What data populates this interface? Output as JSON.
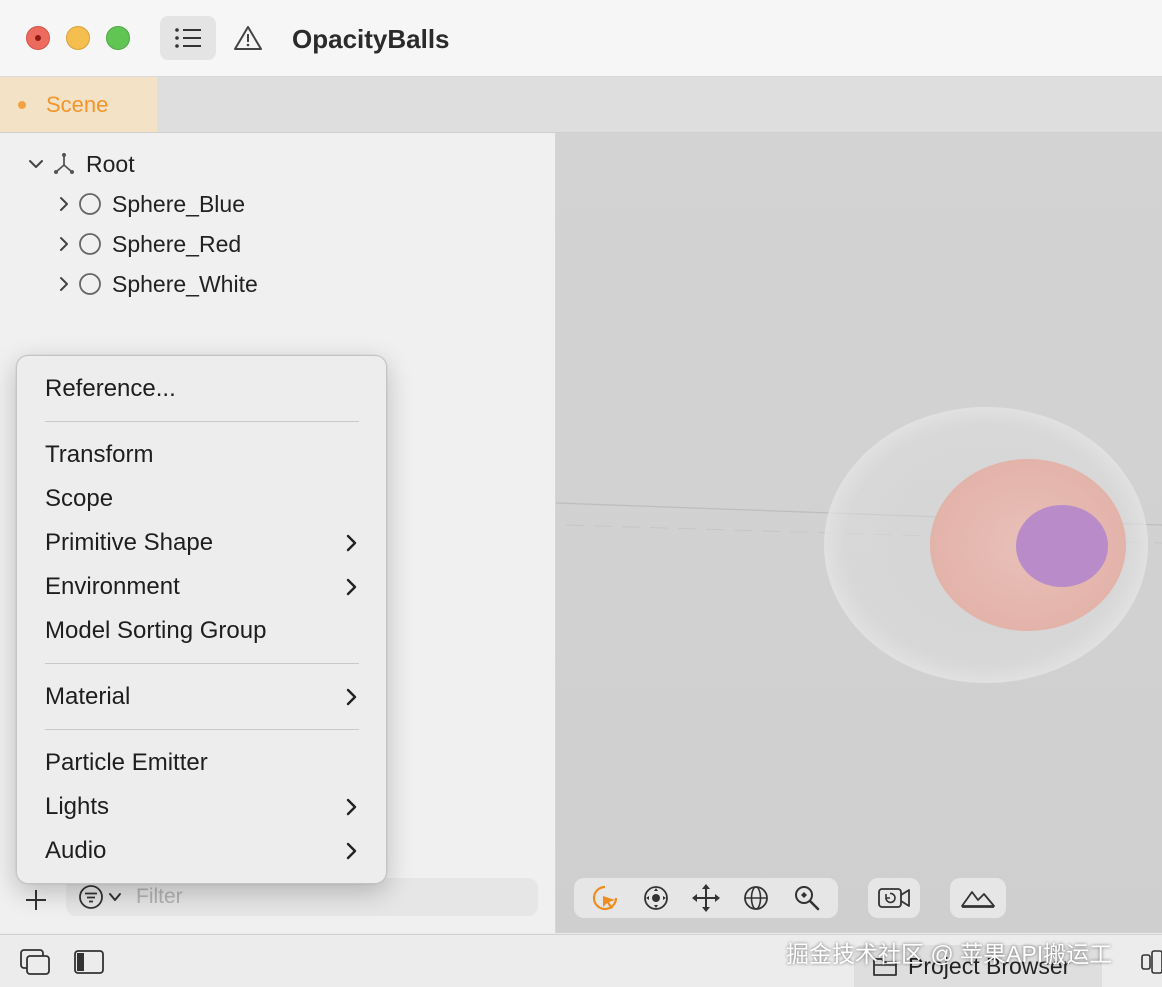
{
  "window": {
    "title": "OpacityBalls"
  },
  "tabs": [
    {
      "label": "Scene",
      "active": true
    }
  ],
  "hierarchy": {
    "root": {
      "label": "Root",
      "expanded": true
    },
    "children": [
      {
        "label": "Sphere_Blue"
      },
      {
        "label": "Sphere_Red"
      },
      {
        "label": "Sphere_White"
      }
    ]
  },
  "context_menu": {
    "items": [
      {
        "label": "Reference...",
        "submenu": false
      },
      {
        "label": "Transform",
        "submenu": false
      },
      {
        "label": "Scope",
        "submenu": false
      },
      {
        "label": "Primitive Shape",
        "submenu": true
      },
      {
        "label": "Environment",
        "submenu": true
      },
      {
        "label": "Model Sorting Group",
        "submenu": false
      },
      {
        "label": "Material",
        "submenu": true
      },
      {
        "label": "Particle Emitter",
        "submenu": false
      },
      {
        "label": "Lights",
        "submenu": true
      },
      {
        "label": "Audio",
        "submenu": true
      }
    ]
  },
  "sidebar_footer": {
    "filter_placeholder": "Filter"
  },
  "viewport_toolbar": {
    "tools": [
      "select-icon",
      "orbit-icon",
      "move-icon",
      "rotate-globe-icon",
      "zoom-icon"
    ],
    "active_tool": "select-icon"
  },
  "statusbar": {
    "project_browser_label": "Project Browser",
    "watermark": "掘金技术社区 @ 苹果API搬运工"
  },
  "colors": {
    "accent_orange": "#f0952b",
    "scene_tab_bg": "#f4e2c6"
  }
}
